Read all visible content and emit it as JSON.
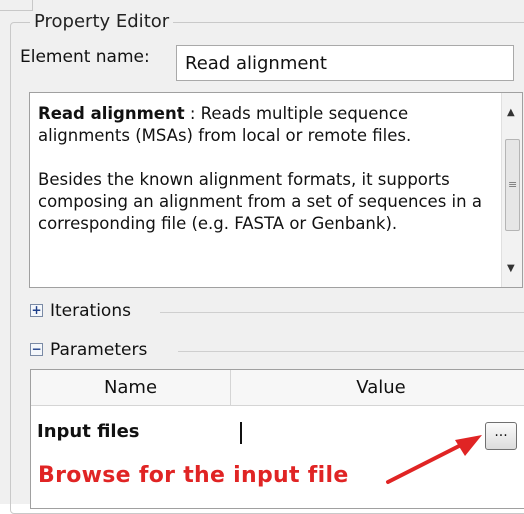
{
  "property_editor": {
    "title": "Property Editor",
    "element_name_label": "Element name:",
    "element_name_value": "Read alignment"
  },
  "description": {
    "title": "Read alignment",
    "title_suffix": " : Reads multiple sequence alignments (MSAs) from local or remote files.",
    "paragraph2": "Besides the known alignment formats, it supports composing an alignment from a set of sequences in a corresponding file (e.g. FASTA or Genbank)."
  },
  "sections": {
    "iterations": {
      "label": "Iterations",
      "toggle": "+"
    },
    "parameters": {
      "label": "Parameters",
      "toggle": "−"
    }
  },
  "parameters_table": {
    "columns": [
      "Name",
      "Value"
    ],
    "rows": [
      {
        "name": "Input files",
        "value": ""
      }
    ],
    "browse_button": "..."
  },
  "annotation": {
    "text": "Browse for the input file",
    "color": "#e02424"
  },
  "icons": [
    "plus-box-icon",
    "minus-box-icon",
    "scroll-up-icon",
    "scroll-down-icon",
    "red-arrow-icon"
  ]
}
